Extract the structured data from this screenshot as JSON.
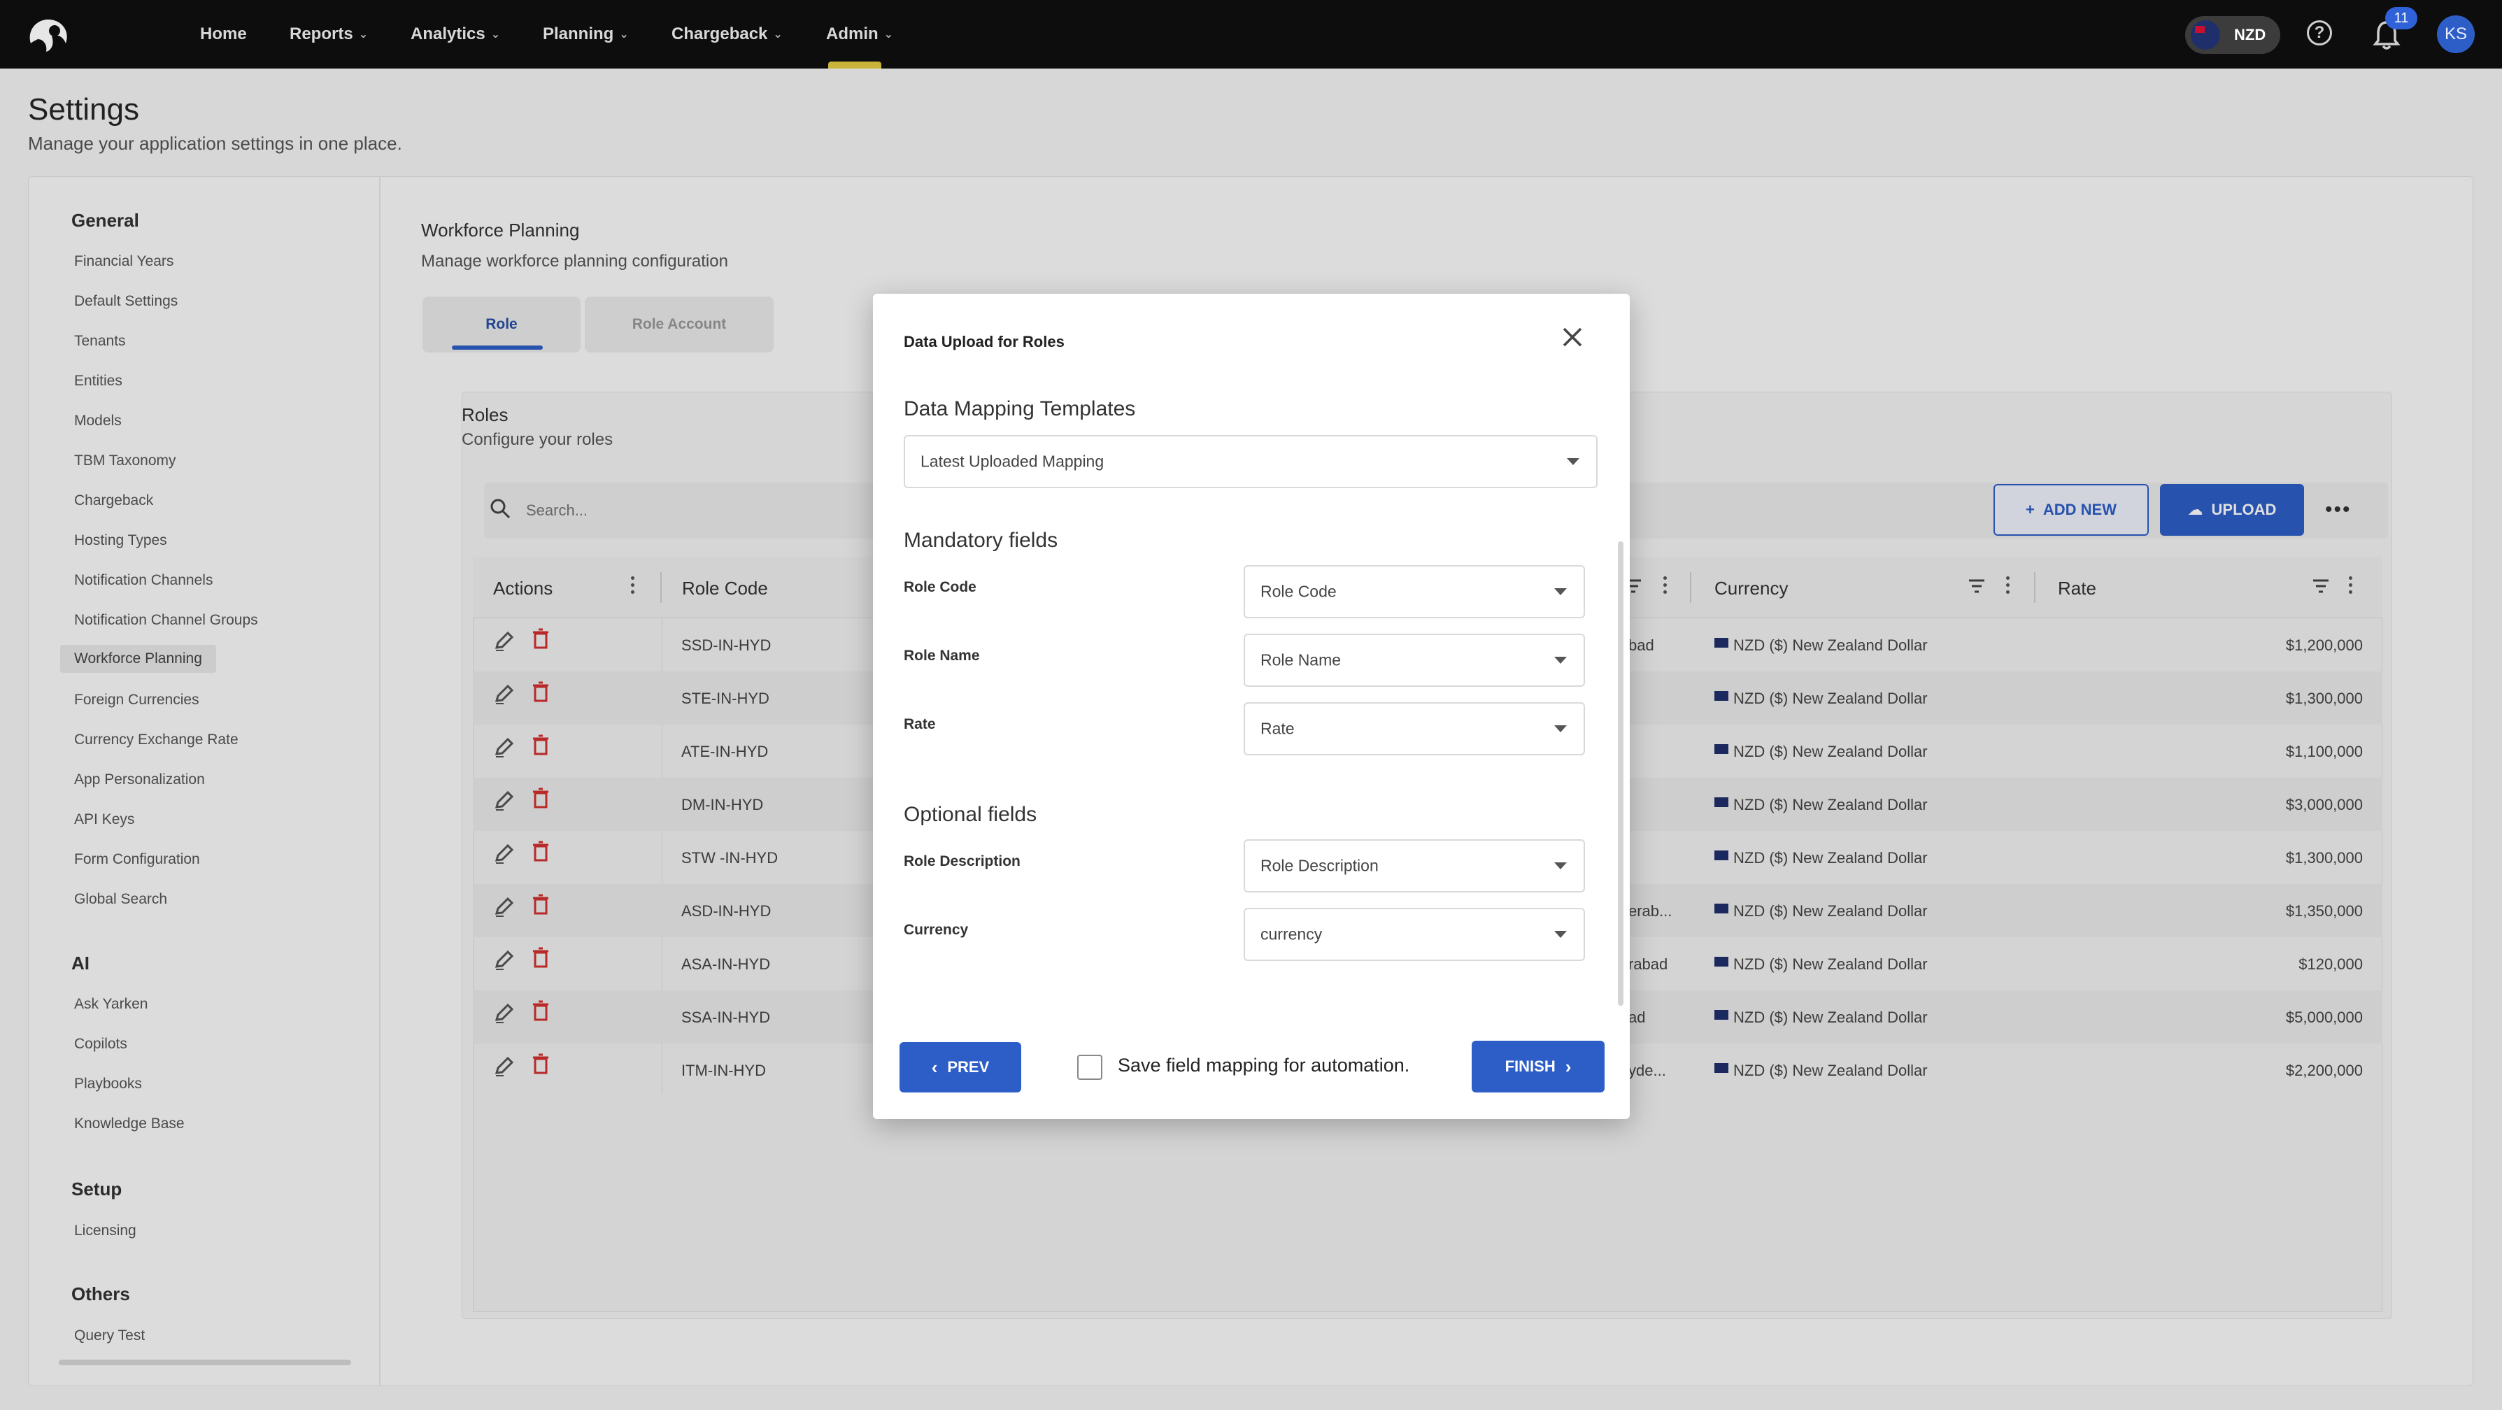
{
  "nav": {
    "items": [
      "Home",
      "Reports",
      "Analytics",
      "Planning",
      "Chargeback",
      "Admin"
    ],
    "currency": "NZD",
    "notifications": "11",
    "avatar_initials": "KS"
  },
  "page": {
    "title": "Settings",
    "subtitle": "Manage your application settings in one place."
  },
  "sidebar": {
    "groups": [
      {
        "title": "General",
        "items": [
          "Financial Years",
          "Default Settings",
          "Tenants",
          "Entities",
          "Models",
          "TBM Taxonomy",
          "Chargeback",
          "Hosting Types",
          "Notification Channels",
          "Notification Channel Groups",
          "Workforce Planning",
          "Foreign Currencies",
          "Currency Exchange Rate",
          "App Personalization",
          "API Keys",
          "Form Configuration",
          "Global Search"
        ]
      },
      {
        "title": "AI",
        "items": [
          "Ask Yarken",
          "Copilots",
          "Playbooks",
          "Knowledge Base"
        ]
      },
      {
        "title": "Setup",
        "items": [
          "Licensing"
        ]
      },
      {
        "title": "Others",
        "items": [
          "Query Test"
        ]
      }
    ],
    "active": "Workforce Planning"
  },
  "workforce": {
    "title": "Workforce Planning",
    "subtitle": "Manage workforce planning configuration",
    "tabs": [
      "Role",
      "Role Account"
    ]
  },
  "roles": {
    "title": "Roles",
    "subtitle": "Configure your roles",
    "search_placeholder": "Search...",
    "add_new": "ADD NEW",
    "upload": "UPLOAD",
    "columns": [
      "Actions",
      "Role Code",
      "Currency",
      "Rate"
    ],
    "rows": [
      {
        "code": "SSD-IN-HYD",
        "frag": "bad",
        "currency": "NZD ($) New Zealand Dollar",
        "rate": "$1,200,000"
      },
      {
        "code": "STE-IN-HYD",
        "frag": "",
        "currency": "NZD ($) New Zealand Dollar",
        "rate": "$1,300,000"
      },
      {
        "code": "ATE-IN-HYD",
        "frag": "",
        "currency": "NZD ($) New Zealand Dollar",
        "rate": "$1,100,000"
      },
      {
        "code": "DM-IN-HYD",
        "frag": "",
        "currency": "NZD ($) New Zealand Dollar",
        "rate": "$3,000,000"
      },
      {
        "code": "STW -IN-HYD",
        "frag": "",
        "currency": "NZD ($) New Zealand Dollar",
        "rate": "$1,300,000"
      },
      {
        "code": "ASD-IN-HYD",
        "frag": "erab...",
        "currency": "NZD ($) New Zealand Dollar",
        "rate": "$1,350,000"
      },
      {
        "code": "ASA-IN-HYD",
        "frag": "rabad",
        "currency": "NZD ($) New Zealand Dollar",
        "rate": "$120,000"
      },
      {
        "code": "SSA-IN-HYD",
        "frag": "ad",
        "currency": "NZD ($) New Zealand Dollar",
        "rate": "$5,000,000"
      },
      {
        "code": "ITM-IN-HYD",
        "frag": "yde...",
        "currency": "NZD ($) New Zealand Dollar",
        "rate": "$2,200,000"
      }
    ]
  },
  "modal": {
    "title": "Data Upload for Roles",
    "templates_heading": "Data Mapping Templates",
    "template_value": "Latest Uploaded Mapping",
    "mandatory_heading": "Mandatory fields",
    "mandatory": [
      {
        "label": "Role Code",
        "value": "Role Code"
      },
      {
        "label": "Role Name",
        "value": "Role Name"
      },
      {
        "label": "Rate",
        "value": "Rate"
      }
    ],
    "optional_heading": "Optional fields",
    "optional": [
      {
        "label": "Role Description",
        "value": "Role Description"
      },
      {
        "label": "Currency",
        "value": "currency"
      }
    ],
    "prev": "PREV",
    "save_mapping": "Save field mapping for automation.",
    "finish": "FINISH"
  },
  "colors": {
    "primary": "#2d5ec7",
    "nav_bg": "#0d0d0d",
    "delete": "#d32f2f",
    "active_bar": "#c9b33b"
  }
}
